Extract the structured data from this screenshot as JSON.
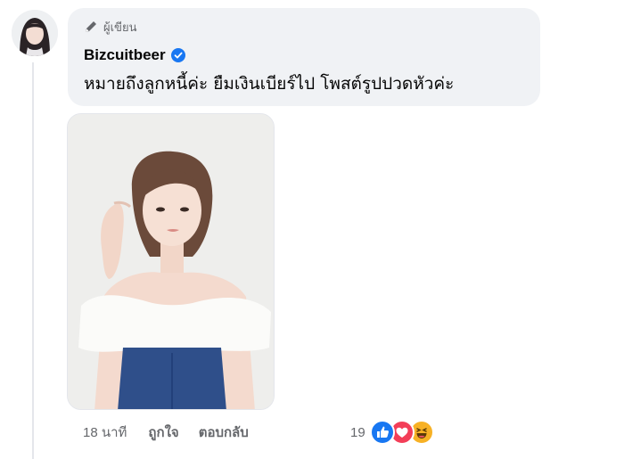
{
  "comment": {
    "author_badge": "ผู้เขียน",
    "author_name": "Bizcuitbeer",
    "text": "หมายถึงลูกหนี้ค่ะ ยืมเงินเบียร์ไป โพสต์รูปปวดหัวค่ะ",
    "timestamp": "18 นาที",
    "like_label": "ถูกใจ",
    "reply_label": "ตอบกลับ",
    "reaction_count": "19"
  },
  "icons": {
    "author_badge": "pencil-icon",
    "verified": "verified-badge-icon",
    "reactions": [
      "like-reaction-icon",
      "love-reaction-icon",
      "haha-reaction-icon"
    ]
  },
  "colors": {
    "bubble": "#f0f2f5",
    "verified": "#1877f2",
    "secondary_text": "#65676b",
    "like": "#1877f2",
    "love": "#f33e58",
    "haha": "#f7b125"
  }
}
